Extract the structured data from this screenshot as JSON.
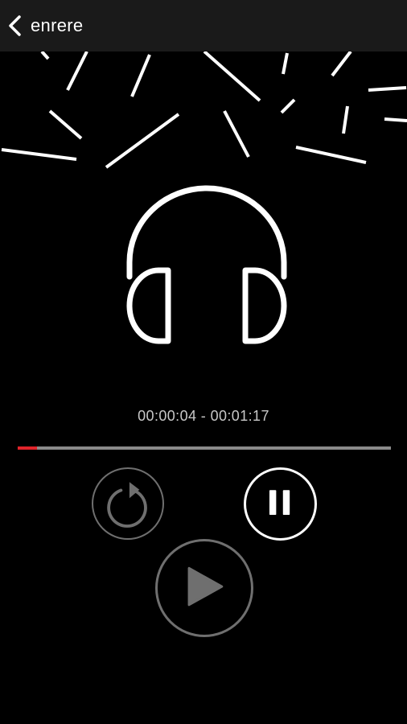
{
  "header": {
    "back_label": "enrere",
    "back_icon": "chevron-left-icon"
  },
  "player": {
    "artwork_icon": "headphones-icon",
    "time_display": "00:00:04 - 00:01:17",
    "progress_fraction": 0.052,
    "controls": {
      "replay_icon": "replay-icon",
      "pause_icon": "pause-icon",
      "play_icon": "play-icon"
    }
  },
  "colors": {
    "background": "#000000",
    "header_background": "#1a1a1a",
    "progress_fill": "#e0242a",
    "progress_track": "#8a8a8a",
    "inactive_control": "#6f6f6f"
  }
}
